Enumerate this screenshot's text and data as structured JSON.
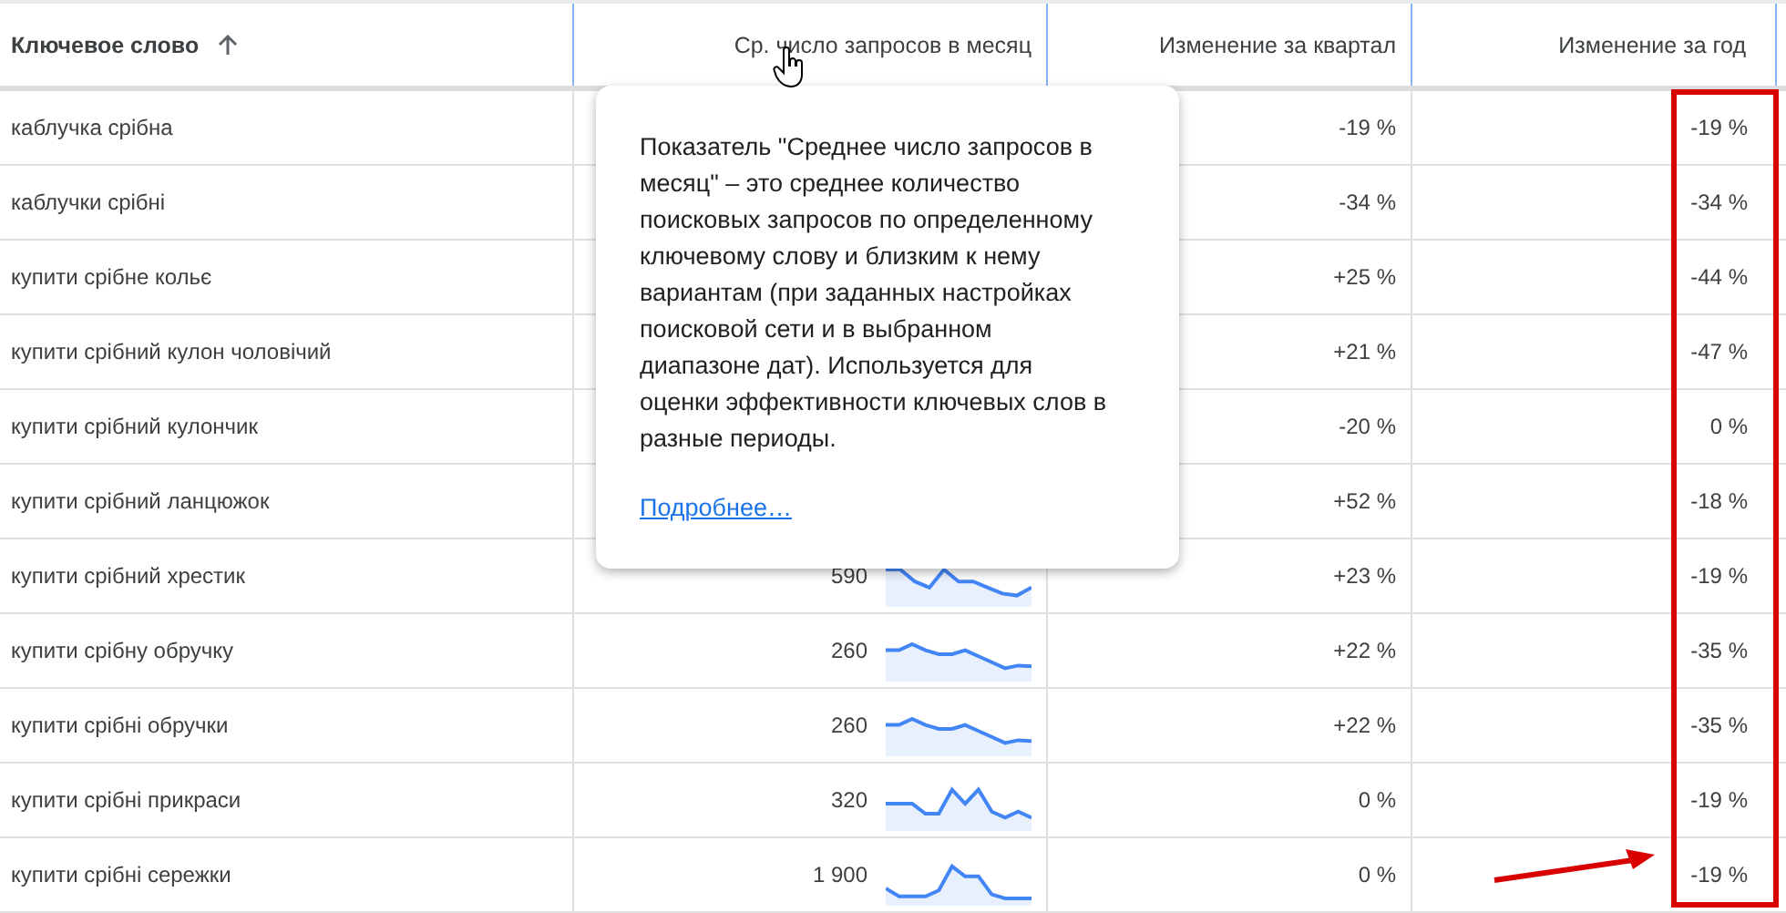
{
  "table": {
    "columns": [
      {
        "label": "Ключевое слово",
        "sorted": true
      },
      {
        "label": "Ср. число запросов в месяц",
        "sorted": false
      },
      {
        "label": "Изменение за квартал",
        "sorted": false
      },
      {
        "label": "Изменение за год",
        "sorted": false
      }
    ],
    "rows": [
      {
        "keyword": "каблучка срібна",
        "quarter_change": "-19 %",
        "year_change": "-19 %"
      },
      {
        "keyword": "каблучки срібні",
        "quarter_change": "-34 %",
        "year_change": "-34 %"
      },
      {
        "keyword": "купити срібне кольє",
        "quarter_change": "+25 %",
        "year_change": "-44 %"
      },
      {
        "keyword": "купити срібний кулон чоловічий",
        "quarter_change": "+21 %",
        "year_change": "-47 %"
      },
      {
        "keyword": "купити срібний кулончик",
        "quarter_change": "-20 %",
        "year_change": "0 %"
      },
      {
        "keyword": "купити срібний ланцюжок",
        "quarter_change": "+52 %",
        "year_change": "-18 %"
      },
      {
        "keyword": "купити срібний хрестик",
        "monthly_searches": "590",
        "quarter_change": "+23 %",
        "year_change": "-19 %"
      },
      {
        "keyword": "купити срібну обручку",
        "monthly_searches": "260",
        "quarter_change": "+22 %",
        "year_change": "-35 %"
      },
      {
        "keyword": "купити срібні обручки",
        "monthly_searches": "260",
        "quarter_change": "+22 %",
        "year_change": "-35 %"
      },
      {
        "keyword": "купити срібні прикраси",
        "monthly_searches": "320",
        "quarter_change": "0 %",
        "year_change": "-19 %"
      },
      {
        "keyword": "купити срібні сережки",
        "monthly_searches": "1 900",
        "quarter_change": "0 %",
        "year_change": "-19 %"
      }
    ]
  },
  "tooltip": {
    "text": "Показатель \"Среднее число запросов в месяц\" – это среднее количество поисковых запросов по определенному ключевому слову и близким к нему вариантам (при заданных настройках поисковой сети и в выбранном диапазоне дат). Используется для оценки эффективности ключевых слов в разные периоды.",
    "link": "Подробнее…"
  },
  "highlight_box": {
    "color": "#d90000"
  },
  "arrow": {
    "color": "#d90000"
  }
}
